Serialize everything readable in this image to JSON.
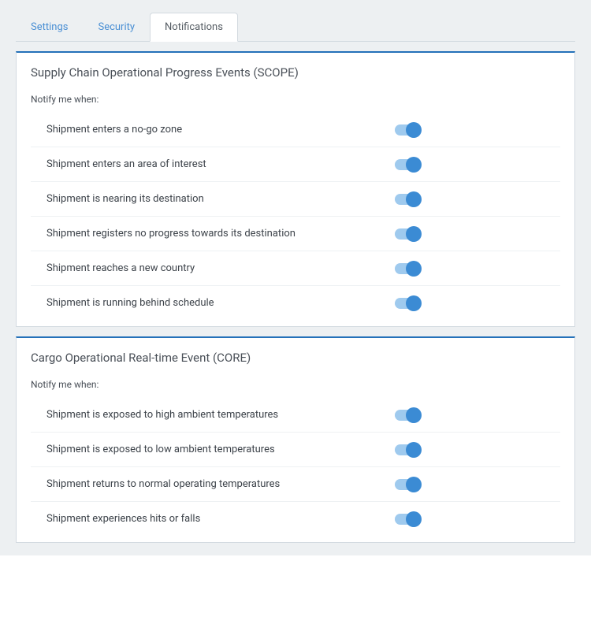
{
  "tabs": {
    "settings": "Settings",
    "security": "Security",
    "notifications": "Notifications"
  },
  "sections": [
    {
      "title": "Supply Chain Operational Progress Events (SCOPE)",
      "notify_label": "Notify me when:",
      "items": [
        {
          "label": "Shipment enters a no-go zone",
          "on": true
        },
        {
          "label": "Shipment enters an area of interest",
          "on": true
        },
        {
          "label": "Shipment is nearing its destination",
          "on": true
        },
        {
          "label": "Shipment registers no progress towards its destination",
          "on": true
        },
        {
          "label": "Shipment reaches a new country",
          "on": true
        },
        {
          "label": "Shipment is running behind schedule",
          "on": true
        }
      ]
    },
    {
      "title": "Cargo Operational Real-time Event (CORE)",
      "notify_label": "Notify me when:",
      "items": [
        {
          "label": "Shipment is exposed to high ambient temperatures",
          "on": true
        },
        {
          "label": "Shipment is exposed to low ambient temperatures",
          "on": true
        },
        {
          "label": "Shipment returns to normal operating temperatures",
          "on": true
        },
        {
          "label": "Shipment experiences hits or falls",
          "on": true
        }
      ]
    }
  ]
}
